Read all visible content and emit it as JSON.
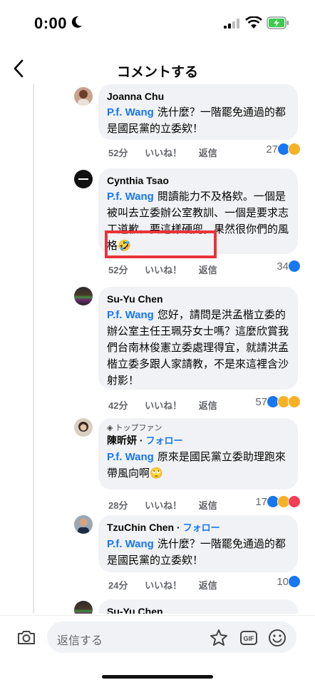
{
  "status": {
    "time": "0:00"
  },
  "header": {
    "title": "コメントする"
  },
  "actions": {
    "like": "いいね！",
    "reply": "返信"
  },
  "comments": [
    {
      "author": "Joanna Chu",
      "follow": "",
      "badge": "",
      "mention": "P.f. Wang",
      "text": "洗什麼？一階罷免通過的都是國民黨的立委欸！",
      "time": "52分",
      "count": "27"
    },
    {
      "author": "Cynthia Tsao",
      "follow": "",
      "badge": "",
      "mention": "P.f. Wang",
      "text": "閱讀能力不及格欸。一個是被叫去立委辦公室教訓、一個是要求志工道歉。要這樣硬兜，果然很你們的風格🤣",
      "time": "52分",
      "count": "34"
    },
    {
      "author": "Su-Yu Chen",
      "follow": "",
      "badge": "",
      "mention": "P.f. Wang",
      "text": "您好，請問是洪孟楷立委的辦公室主任王珮芬女士嗎？這麼欣賞我們台南林俊憲立委處理得宜，就請洪孟楷立委多跟人家請教，不是來這裡含沙射影！",
      "time": "42分",
      "count": "57"
    },
    {
      "author": "陳昕妍",
      "follow": "フォロー",
      "badge": "トップファン",
      "mention": "P.f. Wang",
      "text": "原來是國民黨立委助理跑來帶風向啊🙄",
      "time": "28分",
      "count": "17"
    },
    {
      "author": "TzuChin Chen",
      "follow": "フォロー",
      "badge": "",
      "mention": "P.f. Wang",
      "text": "洗什麼？一階罷免通過的都是國民黨的立委欸！",
      "time": "24分",
      "count": "10"
    },
    {
      "author": "Su-Yu Chen",
      "follow": "",
      "badge": "",
      "mention": "",
      "text": "",
      "time": "",
      "count": ""
    }
  ],
  "composer": {
    "placeholder": "返信する"
  },
  "colors": {
    "accent": "#1877f2",
    "highlight": "#e8333b",
    "bubble": "#f0f2f5"
  }
}
